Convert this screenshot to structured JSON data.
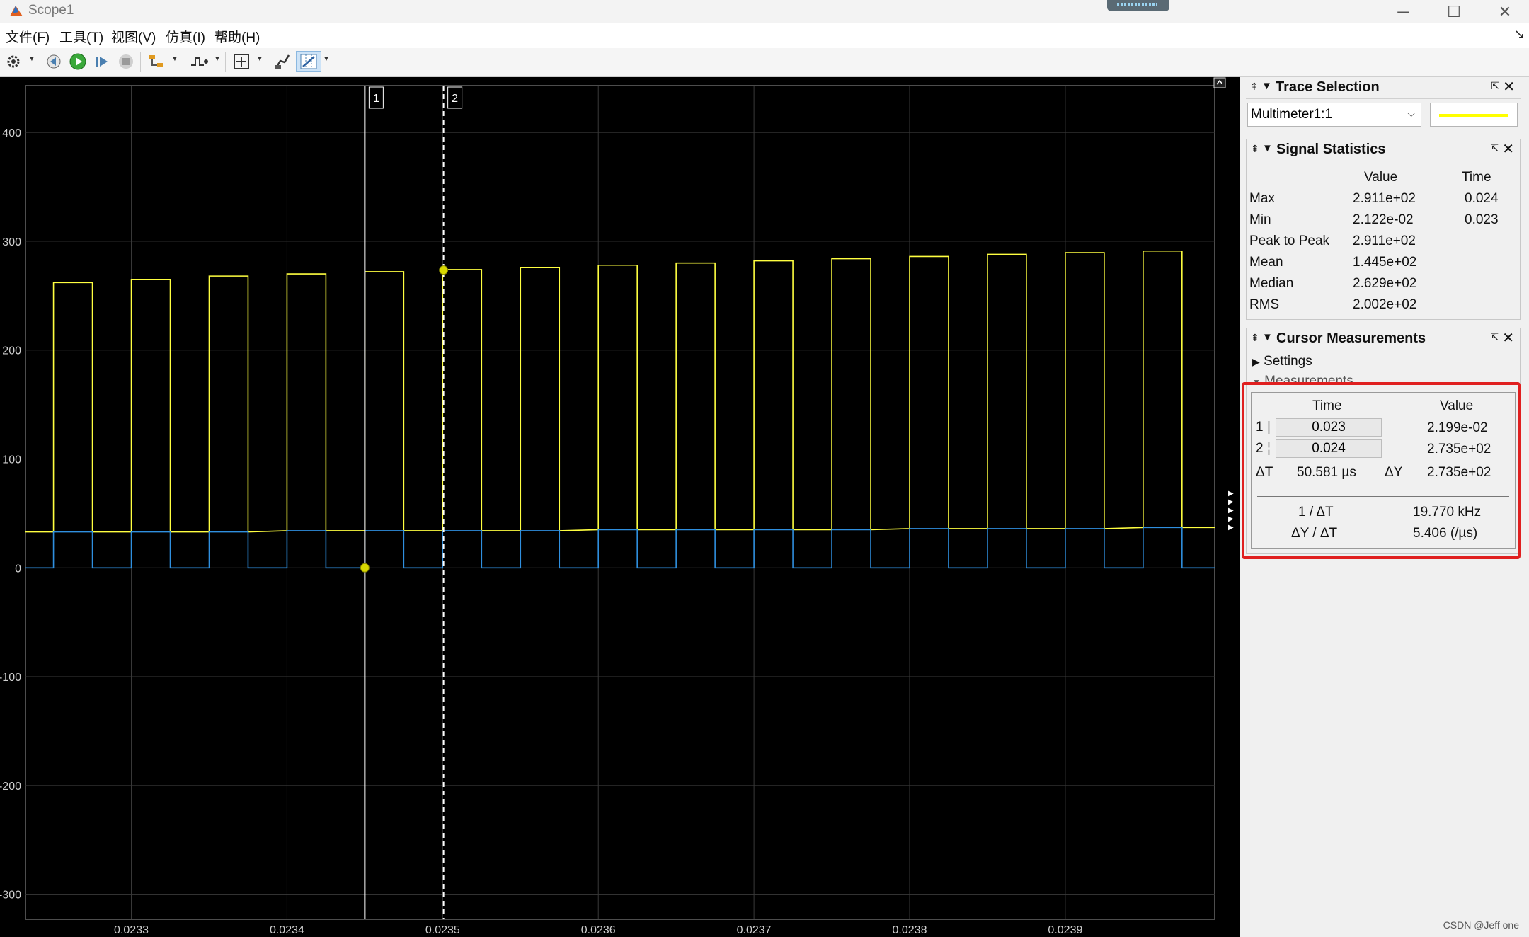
{
  "window": {
    "title": "Scope1"
  },
  "menu": [
    "文件(F)",
    "工具(T)",
    "视图(V)",
    "仿真(I)",
    "帮助(H)"
  ],
  "toolbar": [
    "settings-icon",
    "step-back-icon",
    "run-icon",
    "step-forward-icon",
    "stop-icon",
    "highlight-block-icon",
    "trigger-icon",
    "zoom-fit-icon",
    "write-data-icon",
    "cursor-measurements-icon"
  ],
  "plot": {
    "yticks": [
      "400",
      "300",
      "200",
      "100",
      "0",
      "-100",
      "-200",
      "-300"
    ],
    "xticks": [
      "0.0233",
      "0.0234",
      "0.0235",
      "0.0236",
      "0.0237",
      "0.0238",
      "0.0239"
    ],
    "cursor1_label": "1",
    "cursor2_label": "2",
    "background": "#000000",
    "grid_color": "#3a3a3a"
  },
  "chart_data": {
    "type": "line",
    "xlim": [
      0.023232,
      0.023996
    ],
    "ylim": [
      -323,
      443
    ],
    "grid": true,
    "series": [
      {
        "name": "Multimeter1:1",
        "color": "#ffff40",
        "pulses": [
          {
            "start": 0.02325,
            "end": 0.023275,
            "high": 262,
            "low": 33
          },
          {
            "start": 0.0233,
            "end": 0.023325,
            "high": 265,
            "low": 33
          },
          {
            "start": 0.02335,
            "end": 0.023375,
            "high": 268,
            "low": 33
          },
          {
            "start": 0.0234,
            "end": 0.023425,
            "high": 270,
            "low": 34
          },
          {
            "start": 0.02345,
            "end": 0.023475,
            "high": 272,
            "low": 34
          },
          {
            "start": 0.0235,
            "end": 0.023525,
            "high": 274,
            "low": 34
          },
          {
            "start": 0.02355,
            "end": 0.023575,
            "high": 276,
            "low": 34
          },
          {
            "start": 0.0236,
            "end": 0.023625,
            "high": 278,
            "low": 35
          },
          {
            "start": 0.02365,
            "end": 0.023675,
            "high": 280,
            "low": 35
          },
          {
            "start": 0.0237,
            "end": 0.023725,
            "high": 282,
            "low": 35
          },
          {
            "start": 0.02375,
            "end": 0.023775,
            "high": 284,
            "low": 35
          },
          {
            "start": 0.0238,
            "end": 0.023825,
            "high": 286,
            "low": 36
          },
          {
            "start": 0.02385,
            "end": 0.023875,
            "high": 288,
            "low": 36
          },
          {
            "start": 0.0239,
            "end": 0.023925,
            "high": 289.5,
            "low": 36
          },
          {
            "start": 0.02395,
            "end": 0.023975,
            "high": 291,
            "low": 37
          }
        ]
      },
      {
        "name": "",
        "color": "#2f8fdf",
        "pulses": [
          {
            "start": 0.02325,
            "end": 0.023275,
            "high": 33,
            "low": 0
          },
          {
            "start": 0.0233,
            "end": 0.023325,
            "high": 33,
            "low": 0
          },
          {
            "start": 0.02335,
            "end": 0.023375,
            "high": 33,
            "low": 0
          },
          {
            "start": 0.0234,
            "end": 0.023425,
            "high": 34,
            "low": 0
          },
          {
            "start": 0.02345,
            "end": 0.023475,
            "high": 34,
            "low": 0
          },
          {
            "start": 0.0235,
            "end": 0.023525,
            "high": 34,
            "low": 0
          },
          {
            "start": 0.02355,
            "end": 0.023575,
            "high": 34,
            "low": 0
          },
          {
            "start": 0.0236,
            "end": 0.023625,
            "high": 35,
            "low": 0
          },
          {
            "start": 0.02365,
            "end": 0.023675,
            "high": 35,
            "low": 0
          },
          {
            "start": 0.0237,
            "end": 0.023725,
            "high": 35,
            "low": 0
          },
          {
            "start": 0.02375,
            "end": 0.023775,
            "high": 35,
            "low": 0
          },
          {
            "start": 0.0238,
            "end": 0.023825,
            "high": 36,
            "low": 0
          },
          {
            "start": 0.02385,
            "end": 0.023875,
            "high": 36,
            "low": 0
          },
          {
            "start": 0.0239,
            "end": 0.023925,
            "high": 36,
            "low": 0
          },
          {
            "start": 0.02395,
            "end": 0.023975,
            "high": 37,
            "low": 0
          }
        ]
      }
    ],
    "cursors": [
      {
        "label": "1",
        "x": 0.02345,
        "y": 0.02199,
        "style": "solid"
      },
      {
        "label": "2",
        "x": 0.0235006,
        "y": 273.5,
        "style": "dashed"
      }
    ]
  },
  "trace_selection": {
    "title": "Trace Selection",
    "value": "Multimeter1:1",
    "color": "#ffff00"
  },
  "signal_statistics": {
    "title": "Signal Statistics",
    "headers": {
      "value": "Value",
      "time": "Time"
    },
    "rows": [
      {
        "label": "Max",
        "value": "2.911e+02",
        "time": "0.024"
      },
      {
        "label": "Min",
        "value": "2.122e-02",
        "time": "0.023"
      },
      {
        "label": "Peak to Peak",
        "value": "2.911e+02",
        "time": ""
      },
      {
        "label": "Mean",
        "value": "1.445e+02",
        "time": ""
      },
      {
        "label": "Median",
        "value": "2.629e+02",
        "time": ""
      },
      {
        "label": "RMS",
        "value": "2.002e+02",
        "time": ""
      }
    ]
  },
  "cursor_measurements": {
    "title": "Cursor Measurements",
    "settings_label": "Settings",
    "measurements_label": "Measurements",
    "headers": {
      "time": "Time",
      "value": "Value"
    },
    "cursor1": {
      "index": "1",
      "time": "0.023",
      "value": "2.199e-02"
    },
    "cursor2": {
      "index": "2",
      "time": "0.024",
      "value": "2.735e+02"
    },
    "dt_label": "ΔT",
    "dt_value": "50.581 µs",
    "dy_label": "ΔY",
    "dy_value": "2.735e+02",
    "inv_dt_label": "1 / ΔT",
    "inv_dt_value": "19.770 kHz",
    "dydt_label": "ΔY / ΔT",
    "dydt_value": "5.406 (/µs)"
  },
  "watermark": "CSDN @Jeff one"
}
